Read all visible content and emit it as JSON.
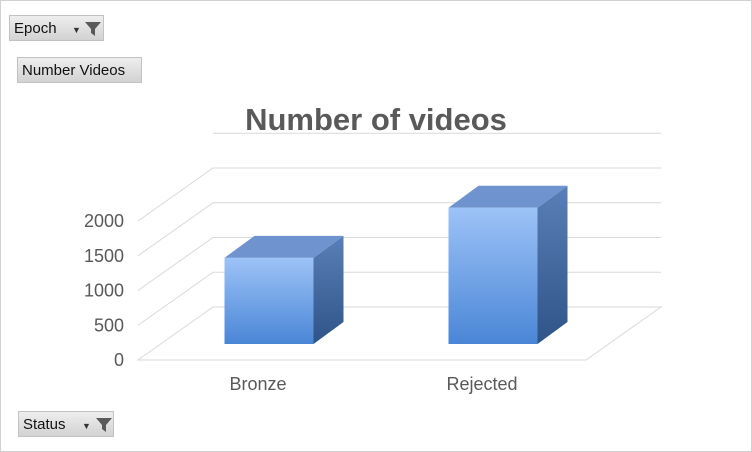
{
  "filters": {
    "report_filter_label": "Epoch",
    "value_field_label": "Number Videos",
    "axis_field_label": "Status",
    "filter_icon": "funnel-icon",
    "dropdown_icon": "chevron-down-icon"
  },
  "chart_data": {
    "type": "bar",
    "style": "3d-column",
    "title": "Number of videos",
    "categories": [
      "Bronze",
      "Rejected"
    ],
    "values": [
      1240,
      1960
    ],
    "ylim": [
      0,
      2000
    ],
    "yticks": [
      "0",
      "500",
      "1000",
      "1500",
      "2000"
    ],
    "grid": true,
    "legend": "none",
    "colors": {
      "bar_top": "#9dc3f7",
      "bar_bottom": "#4a86d6",
      "bar_side": "#35609e",
      "bar_cap": "#6f93cf",
      "grid": "#d9d9d9",
      "text": "#595959"
    }
  }
}
